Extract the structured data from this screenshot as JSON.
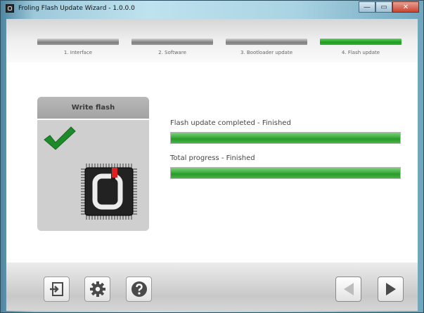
{
  "window": {
    "title": "Froling Flash Update Wizard - 1.0.0.0",
    "controls": {
      "minimize": "—",
      "maximize": "▭",
      "close": "✕"
    }
  },
  "steps": [
    {
      "label": "1. Interface",
      "active": false
    },
    {
      "label": "2. Software",
      "active": false
    },
    {
      "label": "3. Bootloader update",
      "active": false
    },
    {
      "label": "4. Flash update",
      "active": true
    }
  ],
  "card": {
    "title": "Write flash",
    "icons": [
      "checkmark-icon",
      "chip-icon"
    ]
  },
  "progress": [
    {
      "label": "Flash update completed - Finished",
      "value": 100
    },
    {
      "label": "Total progress - Finished",
      "value": 100
    }
  ],
  "footer": {
    "buttons": [
      "exit-icon",
      "settings-icon",
      "help-icon"
    ],
    "nav": {
      "back_enabled": false,
      "next_enabled": true
    }
  },
  "colors": {
    "accent_green": "#2a9a2a",
    "chip_red": "#e02020"
  }
}
